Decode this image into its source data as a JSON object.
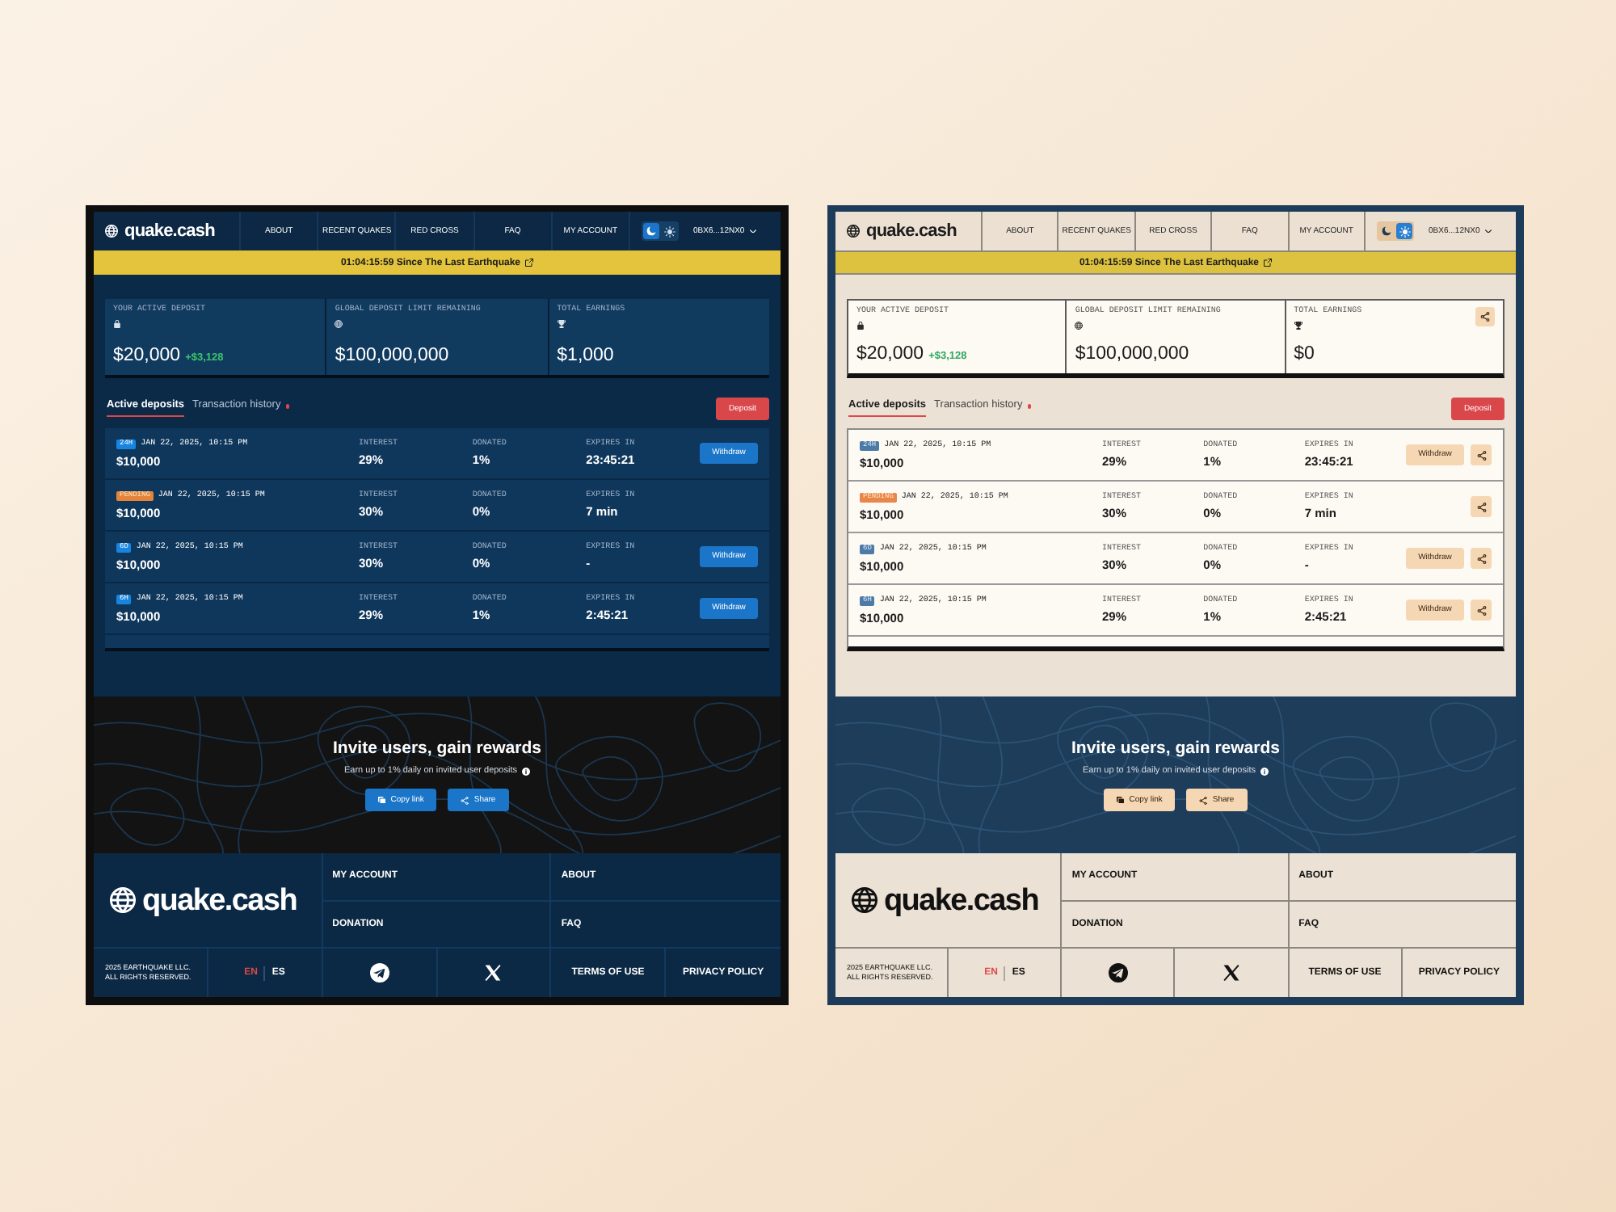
{
  "panels": [
    {
      "kind": "dark",
      "nav": {
        "logo": "quake.cash",
        "links": [
          "ABOUT",
          "RECENT QUAKES",
          "RED CROSS",
          "FAQ",
          "MY ACCOUNT"
        ],
        "theme_toggle": [
          {
            "selected": true
          },
          {
            "selected": false
          }
        ],
        "account": "0BX6...12NX0"
      },
      "banner": {
        "text": "01:04:15:59 Since The Last Earthquake"
      },
      "stats": [
        {
          "label": "YOUR ACTIVE DEPOSIT",
          "value": "$20,000",
          "change": "+$3,128"
        },
        {
          "label": "GLOBAL DEPOSIT LIMIT REMAINING",
          "value": "$100,000,000"
        },
        {
          "label": "TOTAL EARNINGS",
          "value": "$1,000"
        }
      ],
      "tabs": [
        {
          "label": "Active deposits",
          "selected": true,
          "notification": false
        },
        {
          "label": "Transaction history",
          "selected": false,
          "notification": true
        }
      ],
      "deposit_button": "Deposit",
      "deposits": [
        {
          "badge": "24H",
          "kind": "active",
          "date": "JAN 22, 2025, 10:15 PM",
          "amount": "$10,000",
          "fields": [
            {
              "label": "INTEREST",
              "value": "29%"
            },
            {
              "label": "DONATED",
              "value": "1%"
            },
            {
              "label": "EXPIRES IN",
              "value": "23:45:21"
            }
          ],
          "withdraw": "Withdraw"
        },
        {
          "badge": "PENDING",
          "kind": "pending",
          "date": "JAN 22, 2025, 10:15 PM",
          "amount": "$10,000",
          "fields": [
            {
              "label": "INTEREST",
              "value": "30%"
            },
            {
              "label": "DONATED",
              "value": "0%"
            },
            {
              "label": "EXPIRES IN",
              "value": "7 min"
            }
          ]
        },
        {
          "badge": "6D",
          "kind": "active",
          "date": "JAN 22, 2025, 10:15 PM",
          "amount": "$10,000",
          "fields": [
            {
              "label": "INTEREST",
              "value": "30%"
            },
            {
              "label": "DONATED",
              "value": "0%"
            },
            {
              "label": "EXPIRES IN",
              "value": "-"
            }
          ],
          "withdraw": "Withdraw"
        },
        {
          "badge": "6H",
          "kind": "active",
          "date": "JAN 22, 2025, 10:15 PM",
          "amount": "$10,000",
          "fields": [
            {
              "label": "INTEREST",
              "value": "29%"
            },
            {
              "label": "DONATED",
              "value": "1%"
            },
            {
              "label": "EXPIRES IN",
              "value": "2:45:21"
            }
          ],
          "withdraw": "Withdraw"
        }
      ],
      "invite": {
        "title": "Invite users, gain rewards",
        "text": "Earn up to 1% daily on invited user deposits",
        "buttons": [
          "Copy link",
          "Share"
        ]
      },
      "footer": {
        "logo": "quake.cash",
        "links": [
          "MY ACCOUNT",
          "ABOUT",
          "DONATION",
          "FAQ"
        ],
        "copyright": [
          "2025 EARTHQUAKE LLC.",
          "ALL RIGHTS RESERVED."
        ],
        "languages": [
          {
            "label": "EN",
            "selected": true
          },
          {
            "label": "ES",
            "selected": false
          }
        ],
        "legal": [
          "TERMS OF USE",
          "PRIVACY POLICY"
        ]
      }
    },
    {
      "kind": "light",
      "nav": {
        "logo": "quake.cash",
        "links": [
          "ABOUT",
          "RECENT QUAKES",
          "RED CROSS",
          "FAQ",
          "MY ACCOUNT"
        ],
        "theme_toggle": [
          {
            "selected": false
          },
          {
            "selected": true
          }
        ],
        "account": "0BX6...12NX0"
      },
      "banner": {
        "text": "01:04:15:59 Since The Last Earthquake"
      },
      "stats": [
        {
          "label": "YOUR ACTIVE DEPOSIT",
          "value": "$20,000",
          "change": "+$3,128"
        },
        {
          "label": "GLOBAL DEPOSIT LIMIT REMAINING",
          "value": "$100,000,000"
        },
        {
          "label": "TOTAL EARNINGS",
          "value": "$0",
          "share": true
        }
      ],
      "tabs": [
        {
          "label": "Active deposits",
          "selected": true,
          "notification": false
        },
        {
          "label": "Transaction history",
          "selected": false,
          "notification": true
        }
      ],
      "deposit_button": "Deposit",
      "deposits": [
        {
          "badge": "24H",
          "kind": "active",
          "date": "JAN 22, 2025, 10:15 PM",
          "amount": "$10,000",
          "fields": [
            {
              "label": "INTEREST",
              "value": "29%"
            },
            {
              "label": "DONATED",
              "value": "1%"
            },
            {
              "label": "EXPIRES IN",
              "value": "23:45:21"
            }
          ],
          "withdraw": "Withdraw",
          "share": true
        },
        {
          "badge": "PENDING",
          "kind": "pending",
          "date": "JAN 22, 2025, 10:15 PM",
          "amount": "$10,000",
          "fields": [
            {
              "label": "INTEREST",
              "value": "30%"
            },
            {
              "label": "DONATED",
              "value": "0%"
            },
            {
              "label": "EXPIRES IN",
              "value": "7 min"
            }
          ],
          "share": true
        },
        {
          "badge": "6D",
          "kind": "active",
          "date": "JAN 22, 2025, 10:15 PM",
          "amount": "$10,000",
          "fields": [
            {
              "label": "INTEREST",
              "value": "30%"
            },
            {
              "label": "DONATED",
              "value": "0%"
            },
            {
              "label": "EXPIRES IN",
              "value": "-"
            }
          ],
          "withdraw": "Withdraw",
          "share": true
        },
        {
          "badge": "6H",
          "kind": "active",
          "date": "JAN 22, 2025, 10:15 PM",
          "amount": "$10,000",
          "fields": [
            {
              "label": "INTEREST",
              "value": "29%"
            },
            {
              "label": "DONATED",
              "value": "1%"
            },
            {
              "label": "EXPIRES IN",
              "value": "2:45:21"
            }
          ],
          "withdraw": "Withdraw",
          "share": true
        }
      ],
      "invite": {
        "title": "Invite users, gain rewards",
        "text": "Earn up to 1% daily on invited user deposits",
        "buttons": [
          "Copy link",
          "Share"
        ]
      },
      "footer": {
        "logo": "quake.cash",
        "links": [
          "MY ACCOUNT",
          "ABOUT",
          "DONATION",
          "FAQ"
        ],
        "copyright": [
          "2025 EARTHQUAKE LLC.",
          "ALL RIGHTS RESERVED."
        ],
        "languages": [
          {
            "label": "EN",
            "selected": true
          },
          {
            "label": "ES",
            "selected": false
          }
        ],
        "legal": [
          "TERMS OF USE",
          "PRIVACY POLICY"
        ]
      }
    }
  ]
}
